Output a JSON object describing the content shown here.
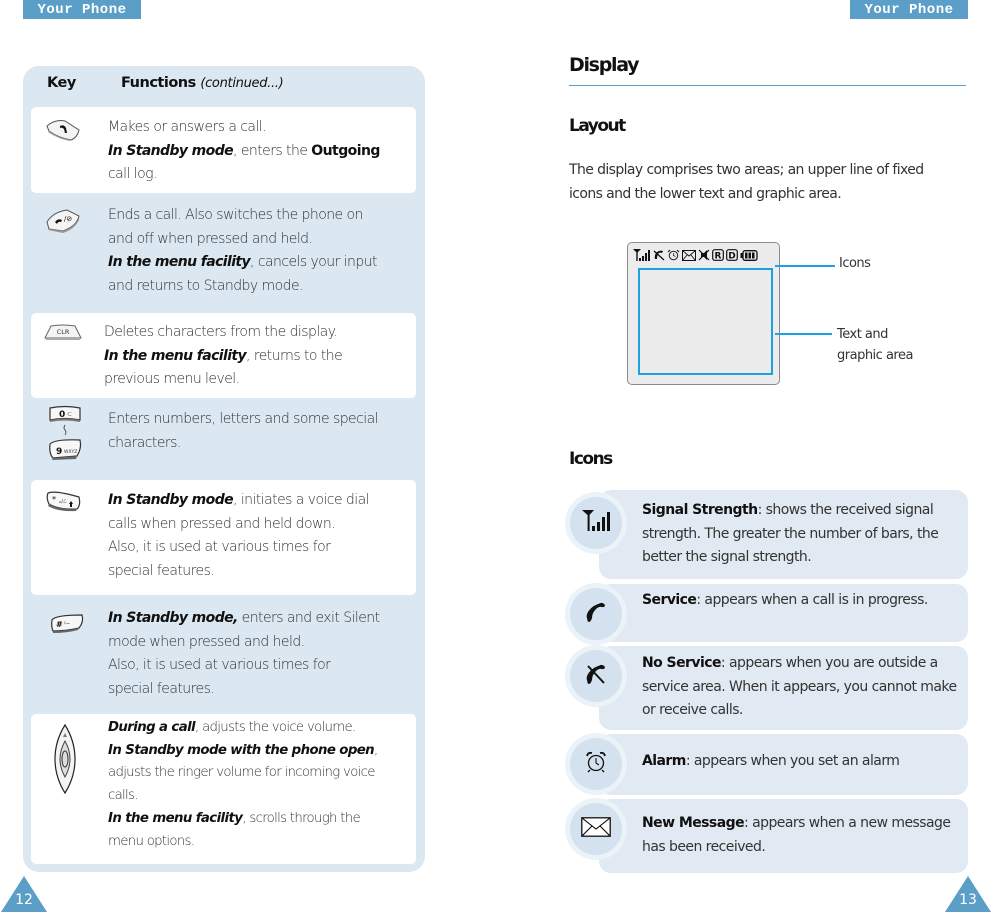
{
  "header": {
    "left_section": "Your Phone",
    "right_section": "Your Phone"
  },
  "pages": {
    "left": "12",
    "right": "13"
  },
  "colors": {
    "accent": "#5b9ec7",
    "panel_bg": "#dbe7f1",
    "callout": "#1da1e0",
    "icon_box_bg": "#e1eaf3"
  },
  "key_table": {
    "col_key": "Key",
    "col_functions": "Functions",
    "col_functions_note": "(continued...)",
    "rows": [
      {
        "icon": "send-key-icon",
        "lines": [
          [
            {
              "t": "Makes or answers a call."
            }
          ],
          [
            {
              "t": "In Standby mode",
              "s": "em"
            },
            {
              "t": ", enters the "
            },
            {
              "t": "Outgoing",
              "s": "b"
            }
          ],
          [
            {
              "t": "call log."
            }
          ]
        ]
      },
      {
        "icon": "end-power-key-icon",
        "lines": [
          [
            {
              "t": "Ends a call. Also switches the phone on"
            }
          ],
          [
            {
              "t": "and off when pressed and held."
            }
          ],
          [
            {
              "t": "In the menu facility",
              "s": "em"
            },
            {
              "t": ", cancels your input"
            }
          ],
          [
            {
              "t": "and returns to Standby mode."
            }
          ]
        ]
      },
      {
        "icon": "clear-key-icon",
        "key_label": "CLR",
        "lines": [
          [
            {
              "t": "Deletes characters from the display."
            }
          ],
          [
            {
              "t": "In the menu facility",
              "s": "em"
            },
            {
              "t": ", returns to the"
            }
          ],
          [
            {
              "t": "previous menu level."
            }
          ]
        ]
      },
      {
        "icon": "number-keys-icon",
        "key_label_top": "0",
        "key_label_bottom": "9",
        "lines": [
          [
            {
              "t": "Enters numbers, letters and some special"
            }
          ],
          [
            {
              "t": "characters."
            }
          ]
        ]
      },
      {
        "icon": "star-key-icon",
        "key_label": "*",
        "lines": [
          [
            {
              "t": "In Standby mode",
              "s": "em"
            },
            {
              "t": ", initiates a voice dial"
            }
          ],
          [
            {
              "t": "calls when pressed and held down."
            }
          ],
          [
            {
              "t": "Also, it is used at various times for"
            }
          ],
          [
            {
              "t": "special features."
            }
          ]
        ]
      },
      {
        "icon": "hash-key-icon",
        "key_label": "#",
        "lines": [
          [
            {
              "t": "In Standby mode,",
              "s": "em"
            },
            {
              "t": " enters and exit Silent"
            }
          ],
          [
            {
              "t": "mode when pressed and held."
            }
          ],
          [
            {
              "t": "Also, it is used at various times for"
            }
          ],
          [
            {
              "t": "special features."
            }
          ]
        ]
      },
      {
        "icon": "volume-key-icon",
        "lines": [
          [
            {
              "t": "During a call",
              "s": "em"
            },
            {
              "t": ", adjusts the voice volume."
            }
          ],
          [
            {
              "t": "In Standby mode with the phone open",
              "s": "em"
            },
            {
              "t": ","
            }
          ],
          [
            {
              "t": "adjusts the ringer volume for incoming voice"
            }
          ],
          [
            {
              "t": "calls."
            }
          ],
          [
            {
              "t": "In the menu facility",
              "s": "em"
            },
            {
              "t": ", scrolls through the"
            }
          ],
          [
            {
              "t": "menu options."
            }
          ]
        ]
      }
    ]
  },
  "display": {
    "title": "Display",
    "layout_title": "Layout",
    "layout_desc": "The display comprises two areas; an upper line of fixed icons and the lower text and graphic area.",
    "status_icons": [
      "signal-icon",
      "no-service-icon",
      "alarm-icon",
      "message-icon",
      "silent-icon",
      "roaming-R-icon",
      "digital-D-icon",
      "battery-icon"
    ],
    "callout_icons": "Icons",
    "callout_text_line1": "Text and",
    "callout_text_line2": "graphic area"
  },
  "icons_section": {
    "title": "Icons",
    "items": [
      {
        "icon": "signal-strength-icon",
        "name": "Signal Strength",
        "desc": ": shows the received signal strength. The greater the number of bars, the better the signal strength."
      },
      {
        "icon": "service-icon",
        "name": "Service",
        "desc": ": appears when a call is in progress."
      },
      {
        "icon": "no-service-icon",
        "name": "No Service",
        "desc": ": appears when you are outside a service area. When it appears, you cannot make or receive calls."
      },
      {
        "icon": "alarm-icon",
        "name": "Alarm",
        "desc": ": appears when you set an alarm"
      },
      {
        "icon": "new-message-icon",
        "name": "New Message",
        "desc": ": appears when a new message has been received."
      }
    ]
  }
}
